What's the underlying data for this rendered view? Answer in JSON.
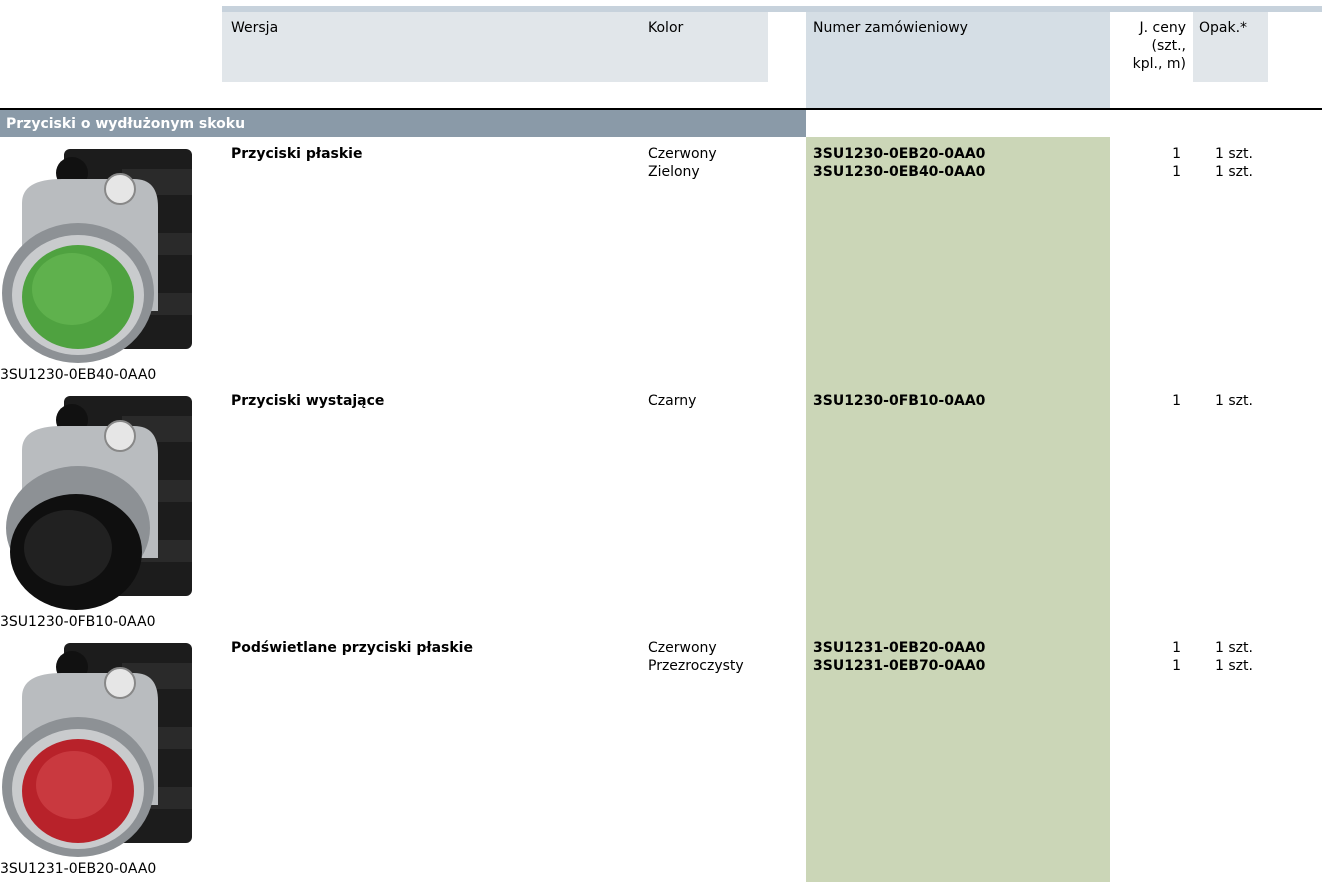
{
  "header": {
    "wersja": "Wersja",
    "kolor": "Kolor",
    "numer": "Numer zamówieniowy",
    "jceny_1": "J. ceny",
    "jceny_2": "(szt.,",
    "jceny_3": "kpl., m)",
    "opak": "Opak.*"
  },
  "section": {
    "title": "Przyciski o wydłużonym skoku"
  },
  "products": [
    {
      "name": "Przyciski płaskie",
      "image_caption": "3SU1230-0EB40-0AA0",
      "button_color": "#4fa240",
      "rows": [
        {
          "color": "Czerwony",
          "order": "3SU1230-0EB20-0AA0",
          "unit": "1",
          "pack": "1 szt."
        },
        {
          "color": "Zielony",
          "order": "3SU1230-0EB40-0AA0",
          "unit": "1",
          "pack": "1 szt."
        }
      ]
    },
    {
      "name": "Przyciski wystające",
      "image_caption": "3SU1230-0FB10-0AA0",
      "button_color": "#1a1a1a",
      "rows": [
        {
          "color": "Czarny",
          "order": "3SU1230-0FB10-0AA0",
          "unit": "1",
          "pack": "1 szt."
        }
      ]
    },
    {
      "name": "Podświetlane przyciski płaskie",
      "image_caption": "3SU1231-0EB20-0AA0",
      "button_color": "#b8222a",
      "rows": [
        {
          "color": "Czerwony",
          "order": "3SU1231-0EB20-0AA0",
          "unit": "1",
          "pack": "1 szt."
        },
        {
          "color": "Przezroczysty",
          "order": "3SU1231-0EB70-0AA0",
          "unit": "1",
          "pack": "1 szt."
        }
      ]
    }
  ],
  "colors": {
    "section_bar": "#8a9aa8",
    "order_column": "#cbd6b7",
    "header_light": "#e1e6ea",
    "header_blue": "#d5dee5"
  }
}
